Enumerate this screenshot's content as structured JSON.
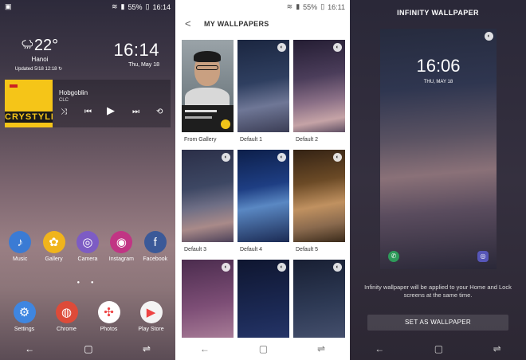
{
  "panel1": {
    "status": {
      "time": "16:14",
      "battery": "55%"
    },
    "weather": {
      "temp": "22°",
      "city": "Hanoi",
      "updated": "Updated 5/18 12:18"
    },
    "clock": {
      "time": "16:14",
      "date": "Thu, May 18"
    },
    "music": {
      "title": "Hobgoblin",
      "artist": "CLC",
      "art_text": "CRYSTYLE"
    },
    "apps_row1": [
      {
        "label": "Music",
        "icon": "music-icon",
        "color": "#3b7bd4",
        "glyph": "♪"
      },
      {
        "label": "Gallery",
        "icon": "gallery-icon",
        "color": "#f0b41c",
        "glyph": "✿"
      },
      {
        "label": "Camera",
        "icon": "camera-icon",
        "color": "#7d5cc4",
        "glyph": "◎"
      },
      {
        "label": "Instagram",
        "icon": "instagram-icon",
        "color": "#c13584",
        "glyph": "◉"
      },
      {
        "label": "Facebook",
        "icon": "facebook-icon",
        "color": "#3b5998",
        "glyph": "f"
      }
    ],
    "apps_row2": [
      {
        "label": "Settings",
        "icon": "settings-icon",
        "color": "#3f86e0",
        "glyph": "⚙"
      },
      {
        "label": "Chrome",
        "icon": "chrome-icon",
        "color": "#dd4b39",
        "glyph": "◍"
      },
      {
        "label": "Photos",
        "icon": "photos-icon",
        "color": "#ffffff",
        "glyph": "✣"
      },
      {
        "label": "Play Store",
        "icon": "play-store-icon",
        "color": "#f4f4f4",
        "glyph": "▶"
      }
    ]
  },
  "panel2": {
    "status": {
      "time": "16:11",
      "battery": "55%"
    },
    "title": "MY WALLPAPERS",
    "items": [
      {
        "label": "From Gallery",
        "style": "gallery"
      },
      {
        "label": "Default 1",
        "style": "w1"
      },
      {
        "label": "Default 2",
        "style": "w2"
      },
      {
        "label": "Default 3",
        "style": "w3"
      },
      {
        "label": "Default 4",
        "style": "w4"
      },
      {
        "label": "Default 5",
        "style": "w5"
      },
      {
        "label": "",
        "style": "w6"
      },
      {
        "label": "",
        "style": "w7"
      },
      {
        "label": "",
        "style": "w8"
      }
    ]
  },
  "panel3": {
    "title": "INFINITY WALLPAPER",
    "preview": {
      "time": "16:06",
      "date": "THU, MAY 18"
    },
    "notice": "Infinity wallpaper will be applied to your Home and Lock screens at the same time.",
    "button": "SET AS WALLPAPER"
  }
}
